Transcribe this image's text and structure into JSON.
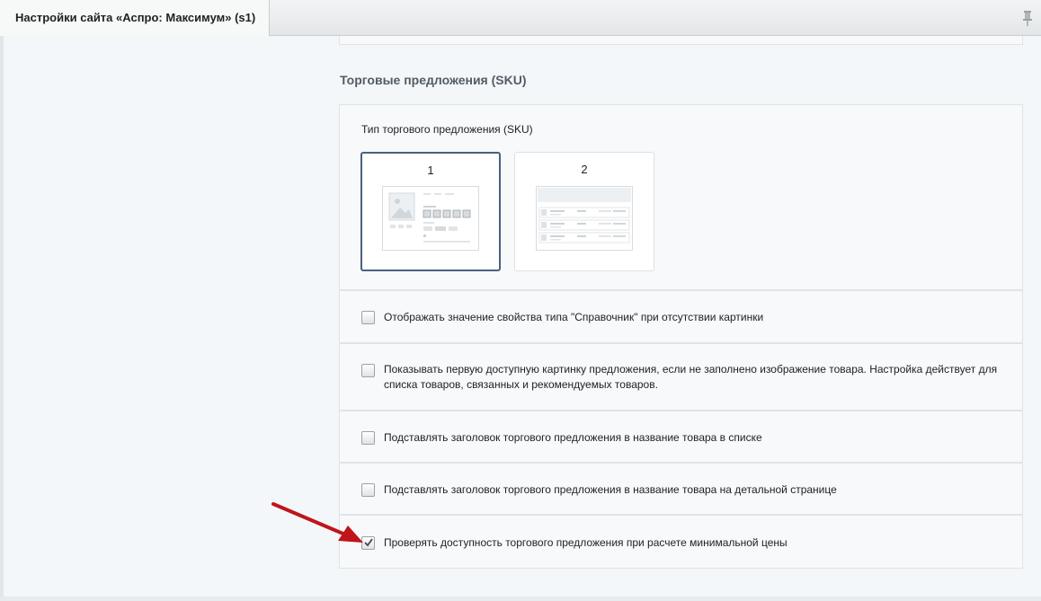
{
  "tab": {
    "title": "Настройки сайта «Аспро: Максимум» (s1)"
  },
  "section": {
    "title": "Торговые предложения (SKU)"
  },
  "sku_type": {
    "label": "Тип торгового предложения (SKU)",
    "options": [
      {
        "label": "1",
        "selected": true
      },
      {
        "label": "2",
        "selected": false
      }
    ]
  },
  "options": [
    {
      "label": "Отображать значение свойства типа \"Справочник\" при отсутствии картинки",
      "checked": false
    },
    {
      "label": "Показывать первую доступную картинку предложения, если не заполнено изображение товара. Настройка действует для списка товаров, связанных и рекомендуемых товаров.",
      "checked": false
    },
    {
      "label": "Подставлять заголовок торгового предложения в название товара в списке",
      "checked": false
    },
    {
      "label": "Подставлять заголовок торгового предложения в название товара на детальной странице",
      "checked": false
    },
    {
      "label": "Проверять доступность торгового предложения при расчете минимальной цены",
      "checked": true
    }
  ],
  "colors": {
    "accent": "#48627e",
    "arrow": "#c0141b"
  }
}
